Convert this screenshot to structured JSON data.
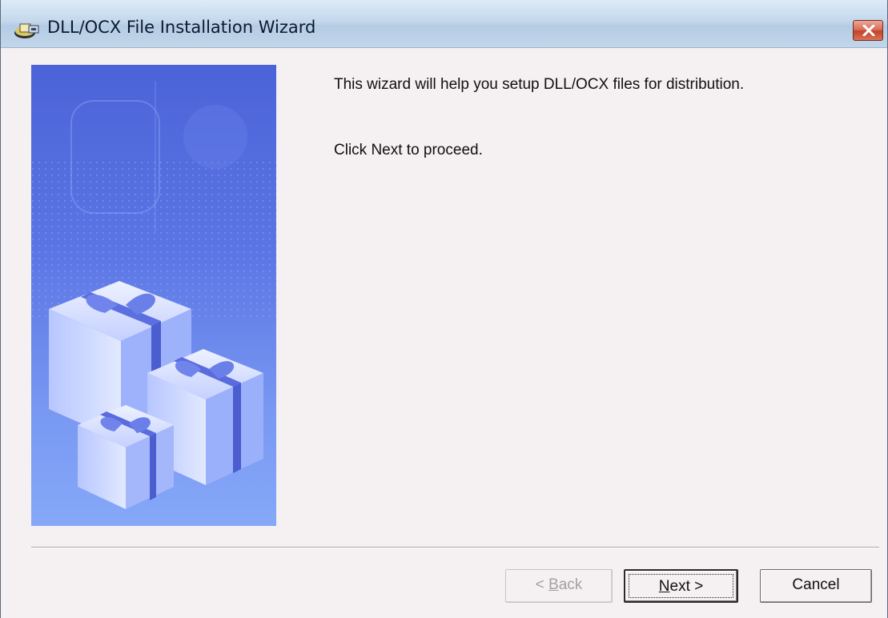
{
  "window": {
    "title": "DLL/OCX File Installation Wizard"
  },
  "content": {
    "line1": "This wizard will help you setup DLL/OCX files for distribution.",
    "line2": "Click Next to proceed."
  },
  "buttons": {
    "back": {
      "prefix": "< ",
      "mnemonic": "B",
      "suffix": "ack",
      "enabled": false
    },
    "next": {
      "prefix": "",
      "mnemonic": "N",
      "suffix": "ext >",
      "enabled": true,
      "focused": true
    },
    "cancel": {
      "label": "Cancel",
      "enabled": true
    }
  },
  "icons": {
    "title_icon": "setup-package-icon",
    "close": "close-icon",
    "side_image": "gift-boxes-illustration"
  },
  "colors": {
    "close_button": "#c4432a",
    "side_image_primary": "#5b75e4",
    "background": "#f5f1f3"
  }
}
